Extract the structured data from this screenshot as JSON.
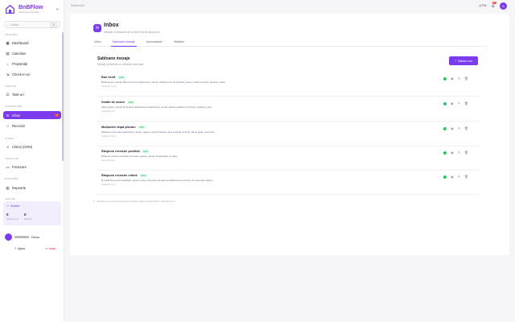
{
  "brand": {
    "title": "BnBFlow",
    "subtitle": "Gestionare proprietăți"
  },
  "search": {
    "placeholder": "Caută...",
    "shortcut": "⌘K"
  },
  "nav": {
    "sections": {
      "principal": "PRINCIPAL",
      "taskuri": "TASK-URI",
      "comunicare": "COMUNICARE",
      "clienti": "CLIENȚI",
      "financiar": "FINANCIAR",
      "rapoarte": "RAPOARTE",
      "analize": "ANALIZE"
    },
    "dashboard": "Dashboard",
    "calendar": "Calendar",
    "proprietati": "Proprietăți",
    "checkin": "Check-in-uri",
    "taskuri": "Task-uri",
    "inbox": "Inbox",
    "inbox_badge": "3",
    "recenzii": "Recenzii",
    "clienti": "Clienți (CRM)",
    "facturare": "Facturare",
    "rapoarte": "Rapoarte"
  },
  "analytics": {
    "title": "Analize",
    "left_value": "0",
    "left_label": "Check-in-uri",
    "right_value": "0",
    "right_label": "Task-uri"
  },
  "user": {
    "name": "Demo"
  },
  "footer": {
    "help": "Ajutor",
    "logout": "Ieșire"
  },
  "topbar": {
    "breadcrumb": "Dashboard",
    "lang": "RO",
    "bell_badge": "9+",
    "avatar": "A"
  },
  "page": {
    "title": "Inbox",
    "subtitle": "Mesaje centralizate de la Airbnb și Booking.com"
  },
  "tabs": [
    "Inbox",
    "Șabloane mesaje",
    "Automatizări",
    "Statistici"
  ],
  "templates": {
    "title": "Șabloane mesaje",
    "subtitle": "Mesaje predefinite cu variabile automate",
    "add_label": "Șablon nou",
    "items": [
      {
        "name": "Bun venit",
        "status": "Activ",
        "desc": "Bună {guest_name}! Bine ai venit la {apartment_name}. Check-in-ul e la {checkin_time}. Codul de acces: {access_code}.",
        "meta": "Folosit de 12 ori"
      },
      {
        "name": "Detalii de sosire",
        "status": "Activ",
        "desc": "Salut {guest_name}! Îți trimitem detalii pentru {apartment_name}: Adresa {address}, Parcare: {parking_info}...",
        "meta": "Folosit de 8 ori"
      },
      {
        "name": "Mulțumire după plecare",
        "status": "Activ",
        "desc": "Mulțumim că ai ales {apartment_name}, {guest_name}! Sperăm că te-ai simțit minunat. Ne-ar ajuta o recenzie...",
        "meta": "Folosit de 15 ori"
      },
      {
        "name": "Răspuns recenzie pozitivă",
        "status": "Activ",
        "desc": "Mulțumim pentru cuvintele frumoase, {guest_name}! Te așteptăm cu drag.",
        "meta": "Folosit de 6 ori"
      },
      {
        "name": "Răspuns recenzie critică",
        "status": "Activ",
        "desc": "Îți mulțumim pentru feedback, {guest_name}. Ne pare rău pentru neplăcerea cu {issue}. Am luat deja măsuri...",
        "meta": "Folosit de 2 ori"
      }
    ]
  },
  "note": "Variabile sunt înlocuite automat la trimitere către oaspeții Airbnb și Booking.com"
}
